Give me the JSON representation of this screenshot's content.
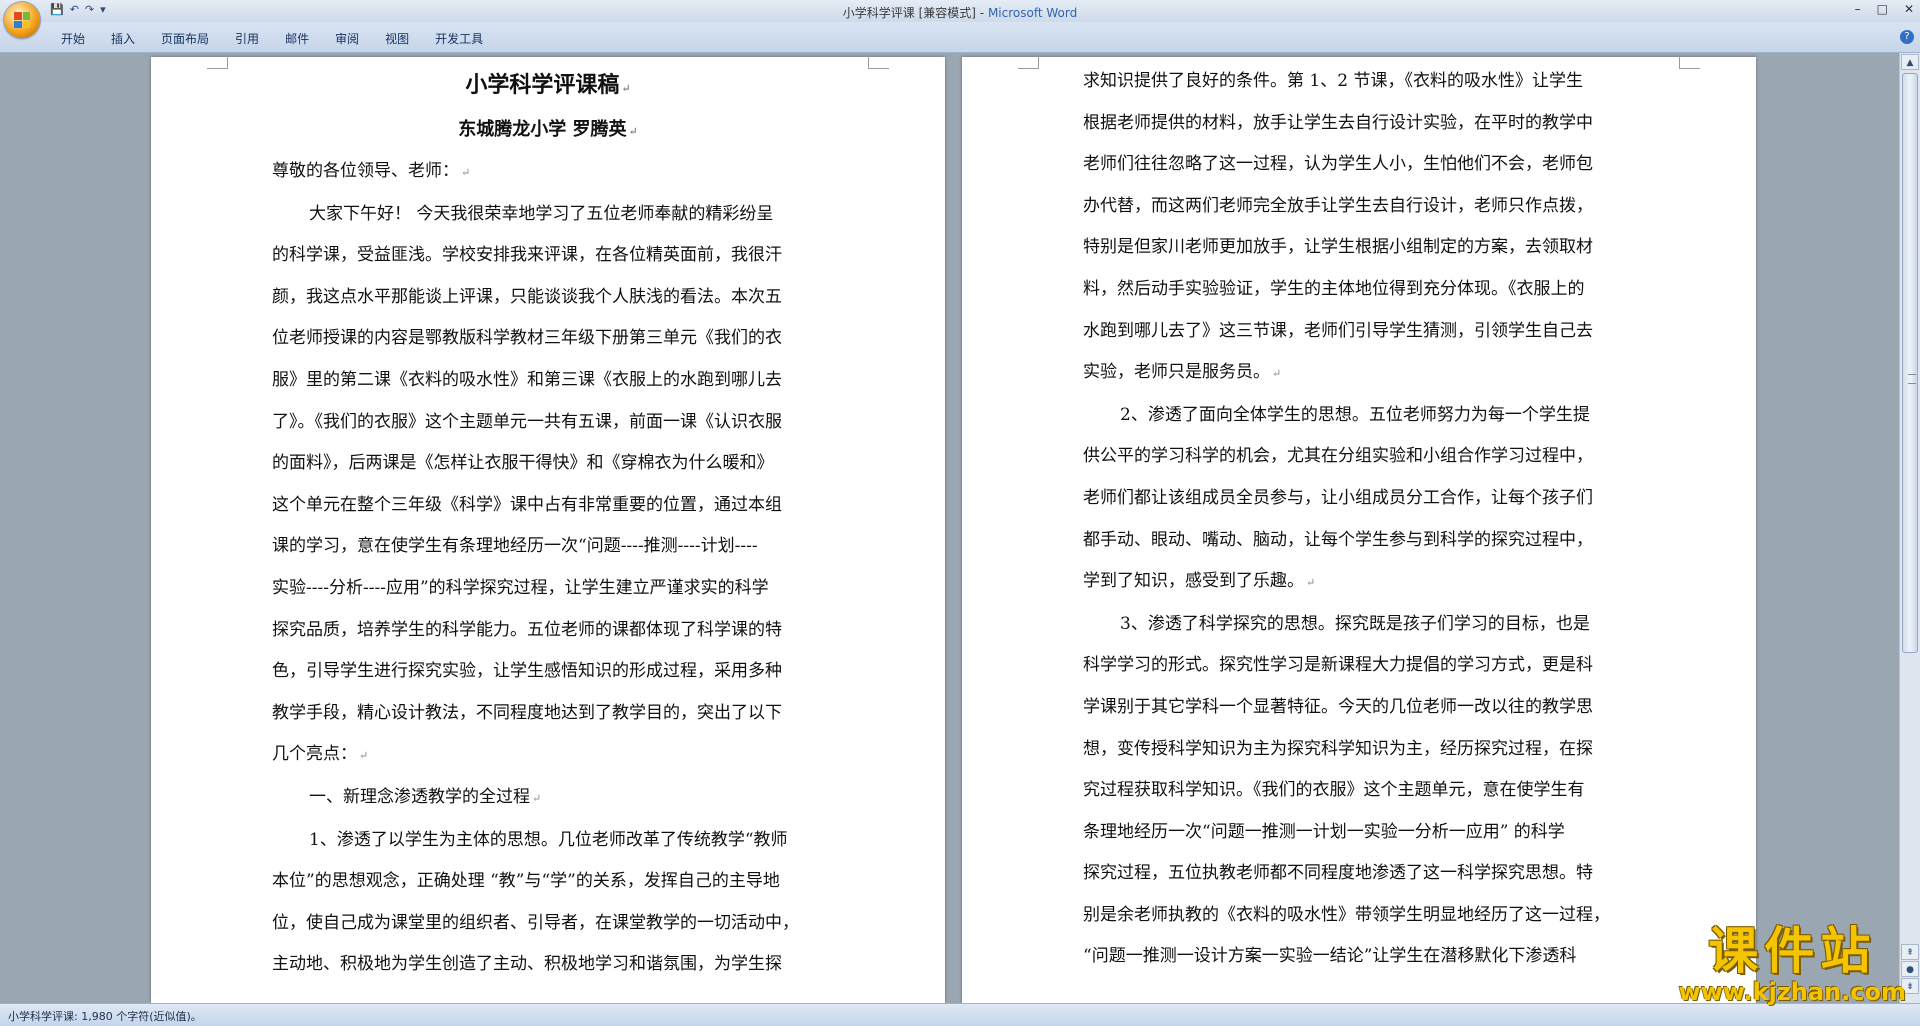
{
  "window": {
    "doc_title": "小学科学评课",
    "mode": "[兼容模式]",
    "separator": " - ",
    "app_name": "Microsoft Word",
    "minimize": "–",
    "maximize": "□",
    "close": "✕"
  },
  "quick_access": {
    "save": "💾",
    "undo": "↶",
    "redo": "↷",
    "customize": "▾"
  },
  "ribbon": {
    "tabs": [
      "开始",
      "插入",
      "页面布局",
      "引用",
      "邮件",
      "审阅",
      "视图",
      "开发工具"
    ],
    "help": "?"
  },
  "page1": {
    "title": "小学科学评课稿",
    "subtitle": "东城腾龙小学    罗腾英",
    "lines": [
      {
        "t": "尊敬的各位领导、老师：",
        "i": false,
        "pm": "↵"
      },
      {
        "t": "大家下午好！  今天我很荣幸地学习了五位老师奉献的精彩纷呈",
        "i": true
      },
      {
        "t": "的科学课，受益匪浅。学校安排我来评课，在各位精英面前，我很汗",
        "i": false
      },
      {
        "t": "颜，我这点水平那能谈上评课，只能谈谈我个人肤浅的看法。本次五",
        "i": false
      },
      {
        "t": "位老师授课的内容是鄂教版科学教材三年级下册第三单元《我们的衣",
        "i": false
      },
      {
        "t": "服》里的第二课《衣料的吸水性》和第三课《衣服上的水跑到哪儿去",
        "i": false
      },
      {
        "t": "了》。《我们的衣服》这个主题单元一共有五课，前面一课《认识衣服",
        "i": false
      },
      {
        "t": "的面料》，后两课是《怎样让衣服干得快》和《穿棉衣为什么暖和》",
        "i": false
      },
      {
        "t": "这个单元在整个三年级《科学》课中占有非常重要的位置，通过本组",
        "i": false
      },
      {
        "t": "课的学习，意在使学生有条理地经历一次“问题----推测----计划----",
        "i": false
      },
      {
        "t": "实验----分析----应用”的科学探究过程，让学生建立严谨求实的科学",
        "i": false
      },
      {
        "t": "探究品质，培养学生的科学能力。五位老师的课都体现了科学课的特",
        "i": false
      },
      {
        "t": "色，引导学生进行探究实验，让学生感悟知识的形成过程，采用多种",
        "i": false
      },
      {
        "t": "教学手段，精心设计教法，不同程度地达到了教学目的，突出了以下",
        "i": false
      },
      {
        "t": "几个亮点：",
        "i": false,
        "pm": "↵"
      },
      {
        "t": "一、新理念渗透教学的全过程",
        "i": true,
        "pm": "↵"
      },
      {
        "t": "1、渗透了以学生为主体的思想。几位老师改革了传统教学“教师",
        "i": true
      },
      {
        "t": "本位”的思想观念，正确处理 “教”与“学”的关系，发挥自己的主导地",
        "i": false
      },
      {
        "t": "位，使自己成为课堂里的组织者、引导者，在课堂教学的一切活动中，",
        "i": false
      },
      {
        "t": "主动地、积极地为学生创造了主动、积极地学习和谐氛围，为学生探",
        "i": false
      }
    ]
  },
  "page2": {
    "lines": [
      {
        "t": "求知识提供了良好的条件。第 1、2 节课，《衣料的吸水性》让学生",
        "i": false
      },
      {
        "t": "根据老师提供的材料，放手让学生去自行设计实验，在平时的教学中",
        "i": false
      },
      {
        "t": "老师们往往忽略了这一过程，认为学生人小，生怕他们不会，老师包",
        "i": false
      },
      {
        "t": "办代替，而这两们老师完全放手让学生去自行设计，老师只作点拨，",
        "i": false
      },
      {
        "t": "特别是但家川老师更加放手，让学生根据小组制定的方案，去领取材",
        "i": false
      },
      {
        "t": "料，然后动手实验验证，学生的主体地位得到充分体现。《衣服上的",
        "i": false
      },
      {
        "t": "水跑到哪儿去了》这三节课，老师们引导学生猜测，引领学生自己去",
        "i": false
      },
      {
        "t": "实验，老师只是服务员。",
        "i": false,
        "pm": "↵"
      },
      {
        "t": "2、渗透了面向全体学生的思想。五位老师努力为每一个学生提",
        "i": true
      },
      {
        "t": "供公平的学习科学的机会，尤其在分组实验和小组合作学习过程中，",
        "i": false
      },
      {
        "t": "老师们都让该组成员全员参与，让小组成员分工合作，让每个孩子们",
        "i": false
      },
      {
        "t": "都手动、眼动、嘴动、脑动，让每个学生参与到科学的探究过程中，",
        "i": false
      },
      {
        "t": "学到了知识，感受到了乐趣。",
        "i": false,
        "pm": "↵"
      },
      {
        "t": "3、渗透了科学探究的思想。探究既是孩子们学习的目标，也是",
        "i": true
      },
      {
        "t": "科学学习的形式。探究性学习是新课程大力提倡的学习方式，更是科",
        "i": false
      },
      {
        "t": "学课别于其它学科一个显著特征。今天的几位老师一改以往的教学思",
        "i": false
      },
      {
        "t": "想，变传授科学知识为主为探究科学知识为主，经历探究过程，在探",
        "i": false
      },
      {
        "t": "究过程获取科学知识。《我们的衣服》这个主题单元，意在使学生有",
        "i": false
      },
      {
        "t": "条理地经历一次“问题一推测一计划一实验一分析一应用”  的科学",
        "i": false
      },
      {
        "t": "探究过程，五位执教老师都不同程度地渗透了这一科学探究思想。特",
        "i": false
      },
      {
        "t": "别是余老师执教的《衣料的吸水性》带领学生明显地经历了这一过程，",
        "i": false
      },
      {
        "t": "“问题一推测一设计方案一实验一结论”让学生在潜移默化下渗透科",
        "i": false
      }
    ]
  },
  "status": {
    "text": "小学科学评课: 1,980 个字符(近似值)。"
  },
  "watermark": {
    "main": "课件站",
    "url": "www.kjzhan.com"
  },
  "colors": {
    "app_blue": "#3064b3",
    "watermark": "#f4c400"
  }
}
